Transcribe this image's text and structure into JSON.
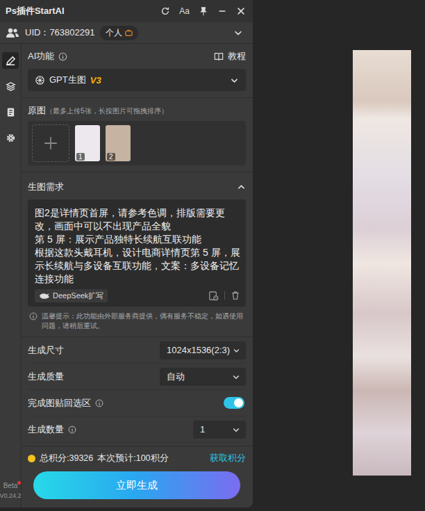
{
  "window": {
    "title": "Ps插件StartAI",
    "font_button": "Aa"
  },
  "user": {
    "uid": "UID：763802291",
    "plan": "个人"
  },
  "sidebar": {
    "items": [
      {
        "kind": "edit",
        "selected": true
      },
      {
        "kind": "layers",
        "selected": false
      },
      {
        "kind": "document",
        "selected": false
      },
      {
        "kind": "settings",
        "selected": false
      }
    ],
    "beta": "Beta",
    "beta_dot": true,
    "version": "V0.24.2"
  },
  "ai_function": {
    "label": "AI功能",
    "tutorial": "教程",
    "model": "GPT生图",
    "model_version": "V3"
  },
  "source_images": {
    "label": "原图",
    "hint": "（最多上传5张，长按图片可拖拽排序）",
    "images": [
      {
        "index": "1",
        "color": "#ece8ee"
      },
      {
        "index": "2",
        "color": "#c7b3a2"
      }
    ]
  },
  "prompt": {
    "label": "生图需求",
    "expanded": true,
    "text": "图2是详情页首屏，请参考色调，排版需要更改，画面中可以不出现产品全貌\n第 5 屏：展示产品独特长续航互联功能\n根据这款头戴耳机，设计电商详情页第 5 屏，展示长续航与多设备互联功能，文案：多设备记忆连接功能",
    "expand_button": "DeepSeek扩写"
  },
  "notice": "温馨提示：此功能由外部服务商提供，偶有服务不稳定，如遇使用问题，请稍后重试。",
  "settings": [
    {
      "kind": "select",
      "label": "生成尺寸",
      "value": "1024x1536(2:3)",
      "help": false,
      "wide": true
    },
    {
      "kind": "select",
      "label": "生成质量",
      "value": "自动",
      "help": false,
      "wide": true
    },
    {
      "kind": "toggle",
      "label": "完成图贴回选区",
      "on": true,
      "help": true
    },
    {
      "kind": "select",
      "label": "生成数量",
      "value": "1",
      "help": true,
      "wide": false
    }
  ],
  "points": {
    "total": "总积分:39326",
    "estimate": "本次预计:100积分",
    "link": "获取积分"
  },
  "generate_button": "立即生成"
}
